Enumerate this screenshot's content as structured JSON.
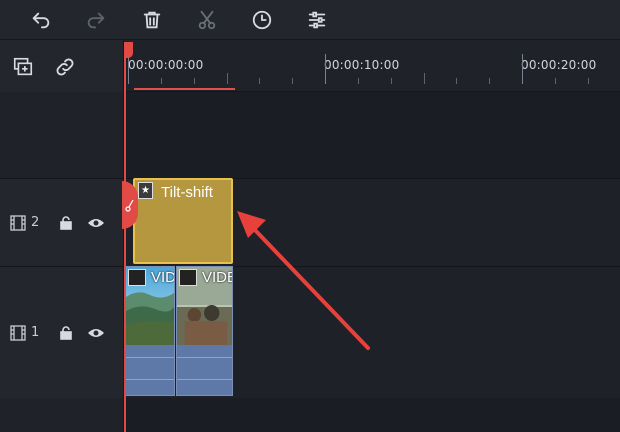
{
  "toolbar": {
    "buttons": [
      {
        "name": "undo",
        "icon": "undo-icon"
      },
      {
        "name": "redo",
        "icon": "redo-icon",
        "disabled": true
      },
      {
        "name": "delete",
        "icon": "trash-icon"
      },
      {
        "name": "cut",
        "icon": "scissors-icon",
        "disabled": true
      },
      {
        "name": "duration",
        "icon": "clock-icon"
      },
      {
        "name": "adjust",
        "icon": "sliders-icon"
      }
    ]
  },
  "ruler": {
    "timecodes": [
      "00:00:00:00",
      "00:00:10:00",
      "00:00:20:00"
    ]
  },
  "tracks": [
    {
      "number": "2",
      "clip": {
        "type": "effect",
        "label": "Tilt-shift"
      }
    },
    {
      "number": "1",
      "clips": [
        {
          "type": "video",
          "label": "VIDEO"
        },
        {
          "type": "video",
          "label": "VIDEO"
        }
      ]
    }
  ],
  "colors": {
    "accent": "#e24a45",
    "effect_clip": "#b5973f",
    "effect_border": "#e7c24d",
    "audio_waveform": "#5e79a8",
    "background": "#1a1d24"
  }
}
